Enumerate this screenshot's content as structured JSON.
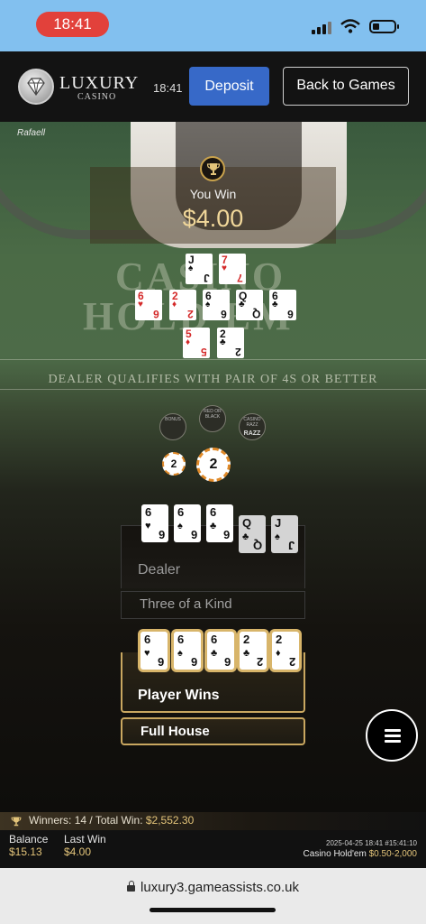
{
  "status_bar": {
    "time": "18:41"
  },
  "header": {
    "logo_title": "LUXURY",
    "logo_subtitle": "CASINO",
    "clock": "18:41",
    "deposit_label": "Deposit",
    "back_label": "Back to Games"
  },
  "table": {
    "dealer_name": "Rafaell",
    "win_label": "You Win",
    "win_amount": "$4.00",
    "felt_title_1": "CASINO",
    "felt_title_2": "HOLD'EM",
    "qualify_text": "DEALER QUALIFIES WITH PAIR OF 4S OR BETTER",
    "side_bets": [
      "BONUS",
      "RED OR BLACK",
      "CASINO RAZZ"
    ],
    "side_bet_razz": "RAZZ",
    "chips": [
      "2",
      "2"
    ],
    "table_cards": {
      "dealer_hole": [
        {
          "rank": "J",
          "suit": "♠"
        },
        {
          "rank": "7",
          "suit": "♥"
        }
      ],
      "community": [
        {
          "rank": "6",
          "suit": "♥"
        },
        {
          "rank": "2",
          "suit": "♦"
        },
        {
          "rank": "6",
          "suit": "♠"
        },
        {
          "rank": "Q",
          "suit": "♣"
        },
        {
          "rank": "6",
          "suit": "♣"
        }
      ],
      "player_hole": [
        {
          "rank": "5",
          "suit": "♦"
        },
        {
          "rank": "2",
          "suit": "♣"
        }
      ]
    }
  },
  "dealer_hand": {
    "label": "Dealer",
    "result": "Three of a Kind",
    "cards": [
      {
        "rank": "6",
        "suit": "♥"
      },
      {
        "rank": "6",
        "suit": "♠"
      },
      {
        "rank": "6",
        "suit": "♣"
      },
      {
        "rank": "Q",
        "suit": "♣"
      },
      {
        "rank": "J",
        "suit": "♠"
      }
    ]
  },
  "player_hand": {
    "label": "Player Wins",
    "result": "Full House",
    "cards": [
      {
        "rank": "6",
        "suit": "♥"
      },
      {
        "rank": "6",
        "suit": "♠"
      },
      {
        "rank": "6",
        "suit": "♣"
      },
      {
        "rank": "2",
        "suit": "♣"
      },
      {
        "rank": "2",
        "suit": "♦"
      }
    ]
  },
  "winners_bar": {
    "winners_label": "Winners:",
    "winners_count": "14",
    "separator": " / ",
    "total_label": "Total Win:",
    "total_amount": "$2,552.30"
  },
  "footer": {
    "balance_label": "Balance",
    "balance_value": "$15.13",
    "last_win_label": "Last Win",
    "last_win_value": "$4.00",
    "timestamp": "2025-04-25 18:41 #15:41:10",
    "game_name": "Casino Hold'em",
    "limits": "$0.50-2,000"
  },
  "browser": {
    "url": "luxury3.gameassists.co.uk"
  },
  "colors": {
    "accent_gold": "#c9a760",
    "deposit_blue": "#3769c8",
    "status_red": "#e2413b"
  }
}
